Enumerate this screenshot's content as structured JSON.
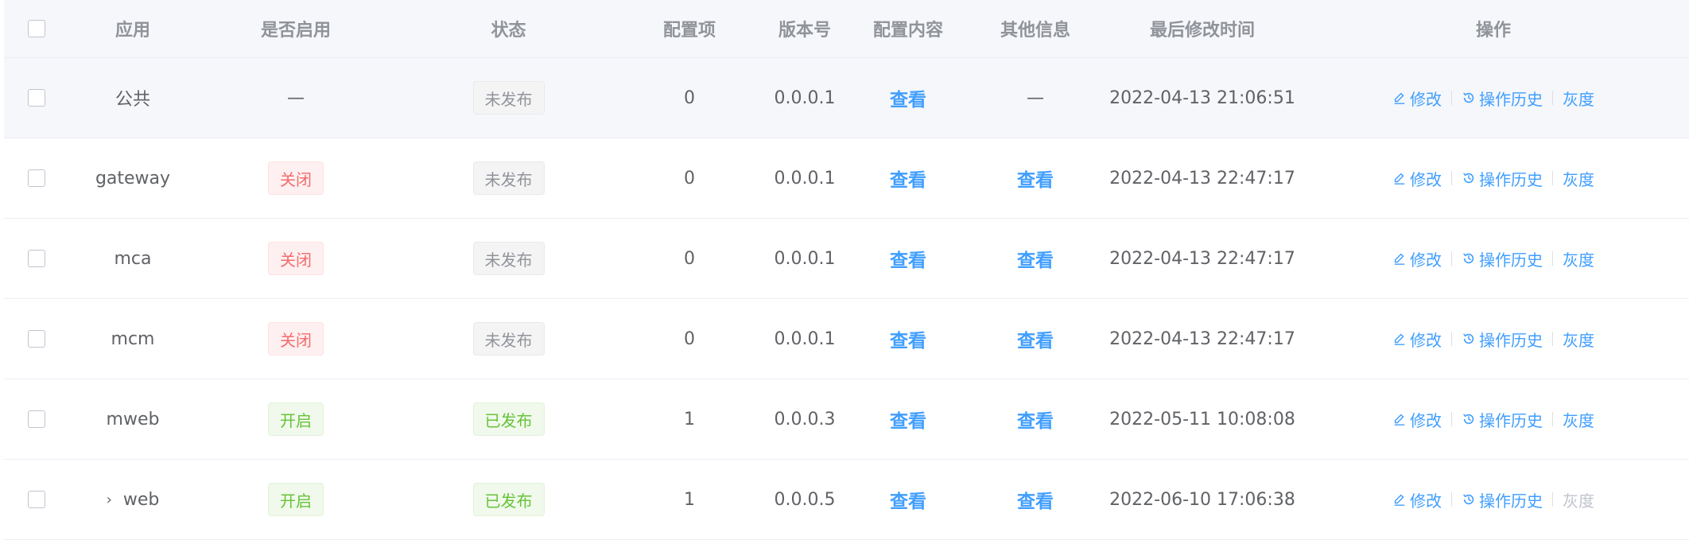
{
  "header": {
    "app": "应用",
    "enabled": "是否启用",
    "status": "状态",
    "items": "配置项",
    "version": "版本号",
    "content": "配置内容",
    "other": "其他信息",
    "time": "最后修改时间",
    "ops": "操作"
  },
  "ops_labels": {
    "edit": "修改",
    "history": "操作历史",
    "gray": "灰度"
  },
  "rows": [
    {
      "app": "公共",
      "enabled": "—",
      "status": "未发布",
      "items": "0",
      "version": "0.0.0.1",
      "content": "查看",
      "other": "—",
      "time": "2022-04-13 21:06:51"
    },
    {
      "app": "gateway",
      "enabled": "关闭",
      "status": "未发布",
      "items": "0",
      "version": "0.0.0.1",
      "content": "查看",
      "other": "查看",
      "time": "2022-04-13 22:47:17"
    },
    {
      "app": "mca",
      "enabled": "关闭",
      "status": "未发布",
      "items": "0",
      "version": "0.0.0.1",
      "content": "查看",
      "other": "查看",
      "time": "2022-04-13 22:47:17"
    },
    {
      "app": "mcm",
      "enabled": "关闭",
      "status": "未发布",
      "items": "0",
      "version": "0.0.0.1",
      "content": "查看",
      "other": "查看",
      "time": "2022-04-13 22:47:17"
    },
    {
      "app": "mweb",
      "enabled": "开启",
      "status": "已发布",
      "items": "1",
      "version": "0.0.0.3",
      "content": "查看",
      "other": "查看",
      "time": "2022-05-11 10:08:08"
    },
    {
      "app": "web",
      "enabled": "开启",
      "status": "已发布",
      "items": "1",
      "version": "0.0.0.5",
      "content": "查看",
      "other": "查看",
      "time": "2022-06-10 17:06:38"
    }
  ],
  "colors": {
    "link": "#409eff",
    "red": "#f56c6c",
    "green": "#67c23a",
    "gray": "#909399",
    "header_bg": "#f5f7fa"
  }
}
